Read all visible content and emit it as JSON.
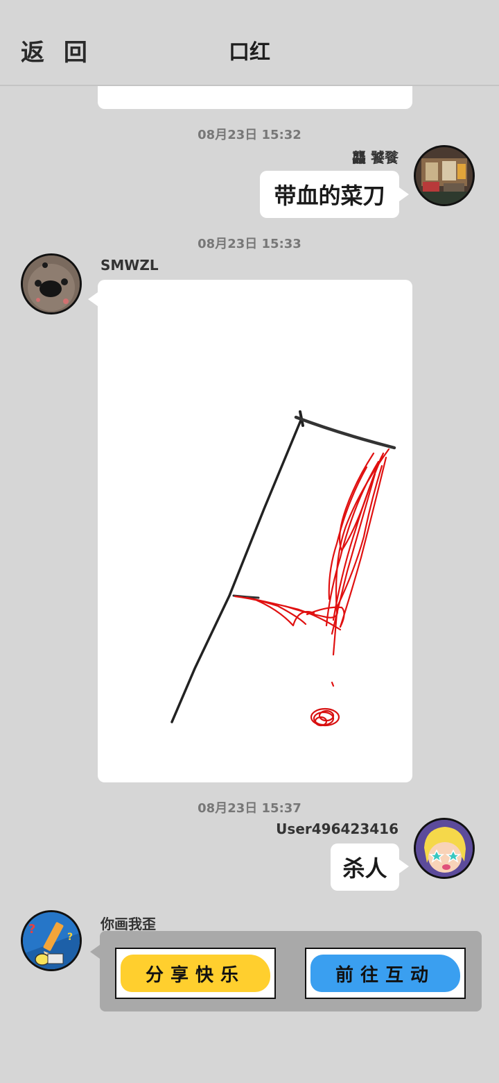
{
  "header": {
    "back_label": "返 回",
    "title": "口红"
  },
  "messages": [
    {
      "timestamp": "08月23日  15:32",
      "user": "龘  饕餮",
      "text": "带血的菜刀"
    },
    {
      "timestamp": "08月23日  15:33",
      "user": "SMWZL"
    },
    {
      "timestamp": "08月23日  15:37",
      "user": "User496423416",
      "text": "杀人"
    }
  ],
  "card": {
    "sender": "你画我歪",
    "share_label": "分享快乐",
    "go_label": "前往互动"
  },
  "colors": {
    "background": "#d6d6d6",
    "bubble": "#ffffff",
    "share_yellow": "#ffcf2e",
    "go_blue": "#3a9ff0",
    "stroke_red": "#e01010"
  }
}
